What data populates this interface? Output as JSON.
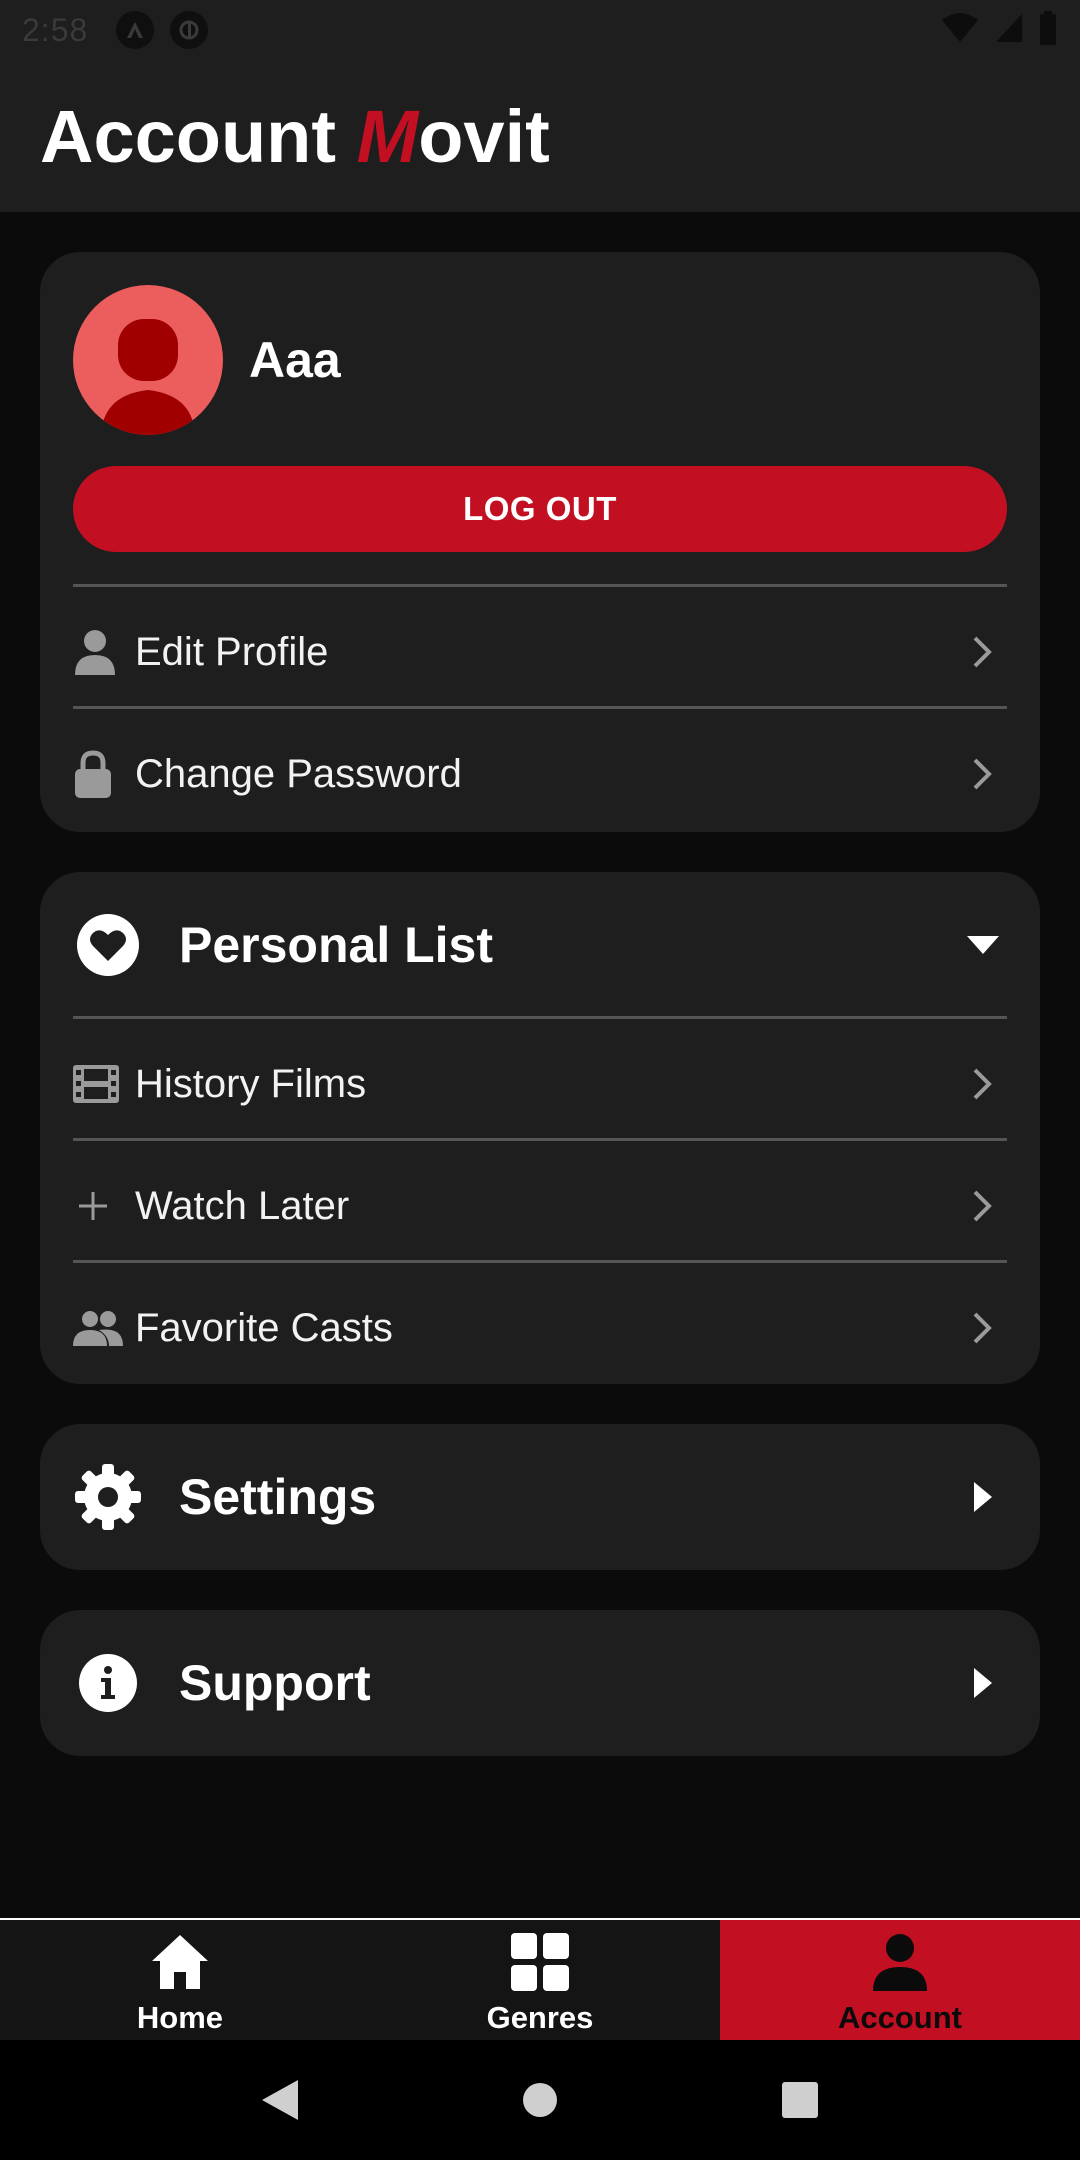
{
  "status_bar": {
    "time": "2:58"
  },
  "header": {
    "title_prefix": "Account ",
    "brand_letter": "M",
    "brand_rest": "ovit"
  },
  "profile": {
    "username": "Aaa",
    "logout_label": "LOG OUT",
    "menu": [
      {
        "label": "Edit Profile",
        "icon": "person-icon"
      },
      {
        "label": "Change Password",
        "icon": "lock-icon"
      }
    ]
  },
  "personal_list": {
    "title": "Personal List",
    "icon": "heart-icon",
    "expanded": true,
    "items": [
      {
        "label": "History Films",
        "icon": "film-icon"
      },
      {
        "label": "Watch Later",
        "icon": "plus-icon"
      },
      {
        "label": "Favorite Casts",
        "icon": "people-icon"
      }
    ]
  },
  "settings": {
    "title": "Settings",
    "icon": "gear-icon"
  },
  "support": {
    "title": "Support",
    "icon": "info-icon"
  },
  "bottom_nav": {
    "items": [
      {
        "label": "Home",
        "icon": "home-icon",
        "active": false
      },
      {
        "label": "Genres",
        "icon": "grid-icon",
        "active": false
      },
      {
        "label": "Account",
        "icon": "account-icon",
        "active": true
      }
    ]
  },
  "colors": {
    "accent": "#c30f22",
    "card": "#1e1e1e",
    "background": "#0b0b0b",
    "avatar_bg": "#ec5d5d"
  }
}
